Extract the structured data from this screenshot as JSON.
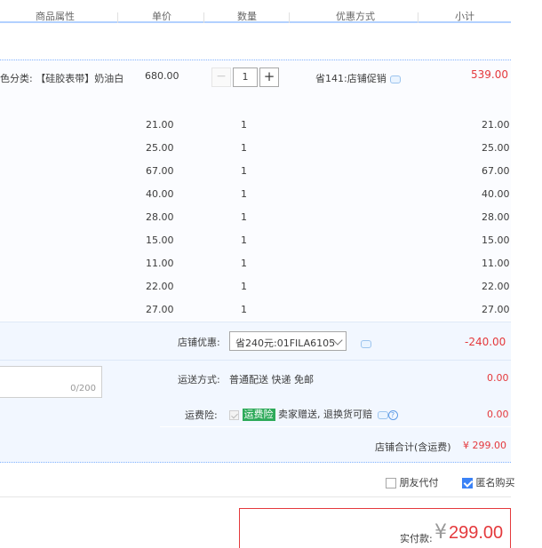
{
  "header": {
    "columns": [
      "商品属性",
      "单价",
      "数量",
      "优惠方式",
      "小计"
    ]
  },
  "item": {
    "attribute": "色分类: 【硅胶表带】奶油白",
    "price": "680.00",
    "quantity": "1",
    "minus": "−",
    "plus": "+",
    "promo": "省141:店铺促销",
    "subtotal": "539.00"
  },
  "sub_items": [
    {
      "price": "21.00",
      "qty": "1",
      "total": "21.00"
    },
    {
      "price": "25.00",
      "qty": "1",
      "total": "25.00"
    },
    {
      "price": "67.00",
      "qty": "1",
      "total": "67.00"
    },
    {
      "price": "40.00",
      "qty": "1",
      "total": "40.00"
    },
    {
      "price": "28.00",
      "qty": "1",
      "total": "28.00"
    },
    {
      "price": "15.00",
      "qty": "1",
      "total": "15.00"
    },
    {
      "price": "11.00",
      "qty": "1",
      "total": "11.00"
    },
    {
      "price": "22.00",
      "qty": "1",
      "total": "22.00"
    },
    {
      "price": "27.00",
      "qty": "1",
      "total": "27.00"
    }
  ],
  "shop": {
    "discount_label": "店铺优惠:",
    "discount_selected": "省240元:01FILA6105",
    "discount_amount": "-240.00",
    "memo_count": "0/200",
    "shipping_label": "运送方式:",
    "shipping_value": "普通配送 快递 免邮",
    "shipping_amount": "0.00",
    "insurance_label": "运费险:",
    "insurance_tag": "运费险",
    "insurance_text": "卖家赠送, 退换货可赔",
    "insurance_amount": "0.00",
    "total_label": "店铺合计(含运费)",
    "total_amount": "¥ 299.00"
  },
  "options": {
    "friend_pay": "朋友代付",
    "anonymous": "匿名购买"
  },
  "payment": {
    "label": "实付款:",
    "symbol": "¥",
    "amount": "299.00"
  },
  "colors": {
    "accent_red": "#e4393c",
    "header_line": "#b2d1ff",
    "panel_bg": "#f2f7ff"
  }
}
